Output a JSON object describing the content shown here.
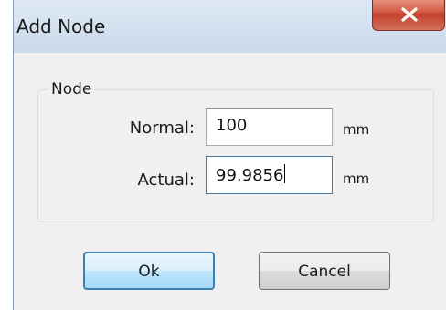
{
  "window": {
    "title": "Add Node",
    "close_glyph": "x"
  },
  "group": {
    "label": "Node"
  },
  "fields": {
    "normal": {
      "label": "Normal:",
      "value": "100",
      "unit": "mm"
    },
    "actual": {
      "label": "Actual:",
      "value": "99.9856",
      "unit": "mm"
    }
  },
  "buttons": {
    "ok": "Ok",
    "cancel": "Cancel"
  },
  "colors": {
    "title_bar": "#d3e0ef",
    "close_button": "#c2412c",
    "focused_button_border": "#3c7fb1"
  },
  "icons": {
    "close": "close-icon"
  }
}
